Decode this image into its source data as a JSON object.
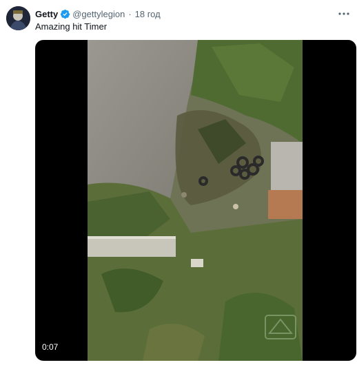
{
  "tweet": {
    "author_name": "Getty",
    "author_handle": "@gettylegion",
    "separator": "·",
    "timestamp": "18 год",
    "text": "Amazing hit Timer",
    "verified_icon": "verified-badge-icon",
    "more_icon": "more-options-icon"
  },
  "video": {
    "duration": "0:07"
  },
  "colors": {
    "verified": "#1d9bf0",
    "text": "#0f1419",
    "secondary": "#536471",
    "media_background": "#000000"
  }
}
